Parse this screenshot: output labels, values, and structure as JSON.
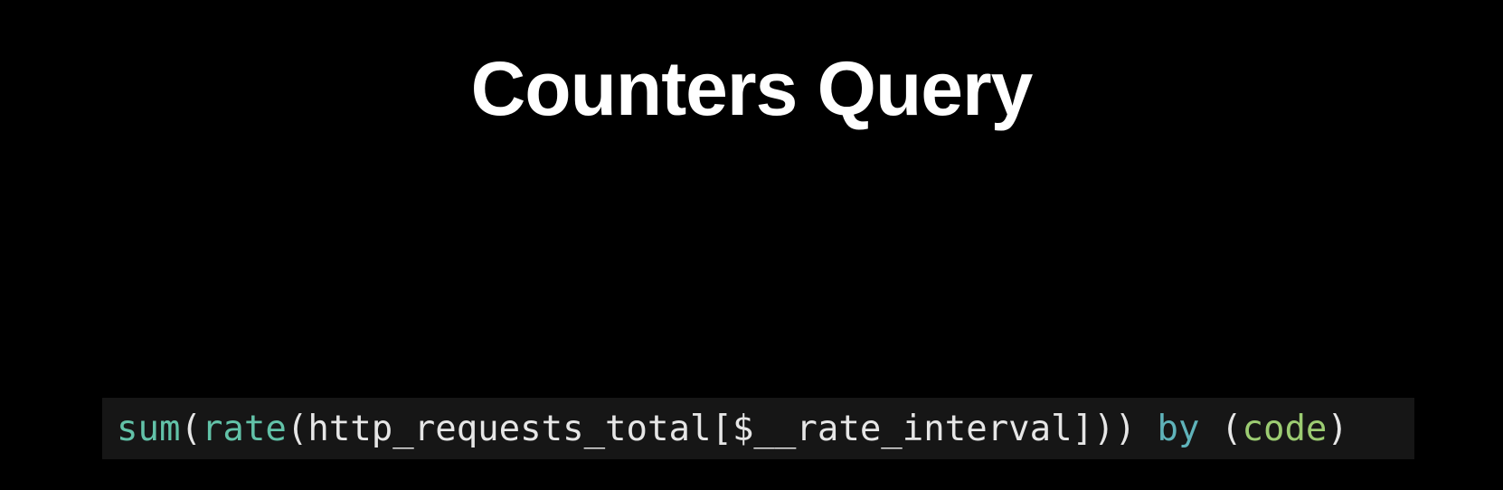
{
  "slide": {
    "title": "Counters Query"
  },
  "code": {
    "tokens": [
      {
        "text": "sum",
        "kind": "function"
      },
      {
        "text": "(",
        "kind": "plain"
      },
      {
        "text": "rate",
        "kind": "function"
      },
      {
        "text": "(http_requests_total[$__rate_interval])) ",
        "kind": "plain"
      },
      {
        "text": "by",
        "kind": "keyword"
      },
      {
        "text": " (",
        "kind": "plain"
      },
      {
        "text": "code",
        "kind": "label"
      },
      {
        "text": ")",
        "kind": "plain"
      }
    ]
  },
  "colors": {
    "background": "#000000",
    "code_background": "#161616",
    "function": "#62c2a8",
    "keyword": "#5fb3ba",
    "label": "#9ccc72",
    "plain": "#e6e6e6"
  }
}
